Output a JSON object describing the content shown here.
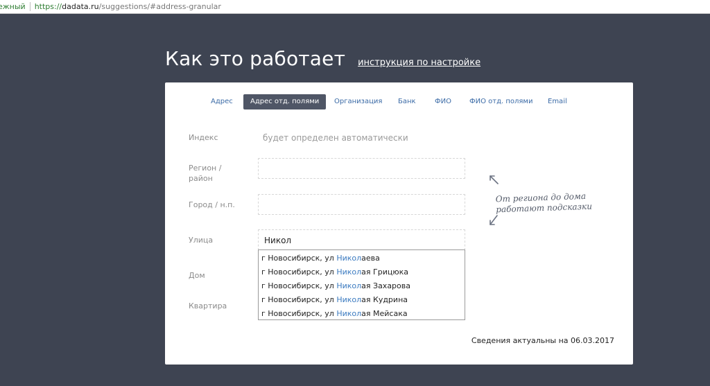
{
  "browser": {
    "secure_label": "ежный",
    "url_scheme": "https://",
    "url_host": "dadata.ru",
    "url_path": "/suggestions/#address-granular"
  },
  "heading": {
    "title": "Как это работает",
    "link": "инструкция по настройке"
  },
  "tabs": [
    {
      "label": "Адрес",
      "active": false
    },
    {
      "label": "Адрес отд. полями",
      "active": true
    },
    {
      "label": "Организация",
      "active": false
    },
    {
      "label": "Банк",
      "active": false
    },
    {
      "label": "ФИО",
      "active": false
    },
    {
      "label": "ФИО отд. полями",
      "active": false
    },
    {
      "label": "Email",
      "active": false
    }
  ],
  "form": {
    "index_label": "Индекс",
    "index_value": "будет определен автоматически",
    "region_label_1": "Регион /",
    "region_label_2": "район",
    "region_value": "",
    "city_label": "Город / н.п.",
    "city_value": "",
    "street_label": "Улица",
    "street_value": "Никол",
    "house_label": "Дом",
    "flat_label": "Квартира"
  },
  "suggestions": [
    {
      "prefix": "г Новосибирск, ул ",
      "match": "Никол",
      "suffix": "аева"
    },
    {
      "prefix": "г Новосибирск, ул ",
      "match": "Никол",
      "suffix": "ая Грицюка"
    },
    {
      "prefix": "г Новосибирск, ул ",
      "match": "Никол",
      "suffix": "ая Захарова"
    },
    {
      "prefix": "г Новосибирск, ул ",
      "match": "Никол",
      "suffix": "ая Кудрина"
    },
    {
      "prefix": "г Новосибирск, ул ",
      "match": "Никол",
      "suffix": "ая Мейсака"
    }
  ],
  "hint": {
    "line1": "От региона до дома",
    "line2": "работают подсказки"
  },
  "footer": {
    "updated": "Сведения актуальны на 06.03.2017"
  },
  "colors": {
    "background": "#3e4452",
    "active_tab": "#4f5666",
    "link": "#3a6aa6",
    "highlight": "#3a7ac0"
  }
}
